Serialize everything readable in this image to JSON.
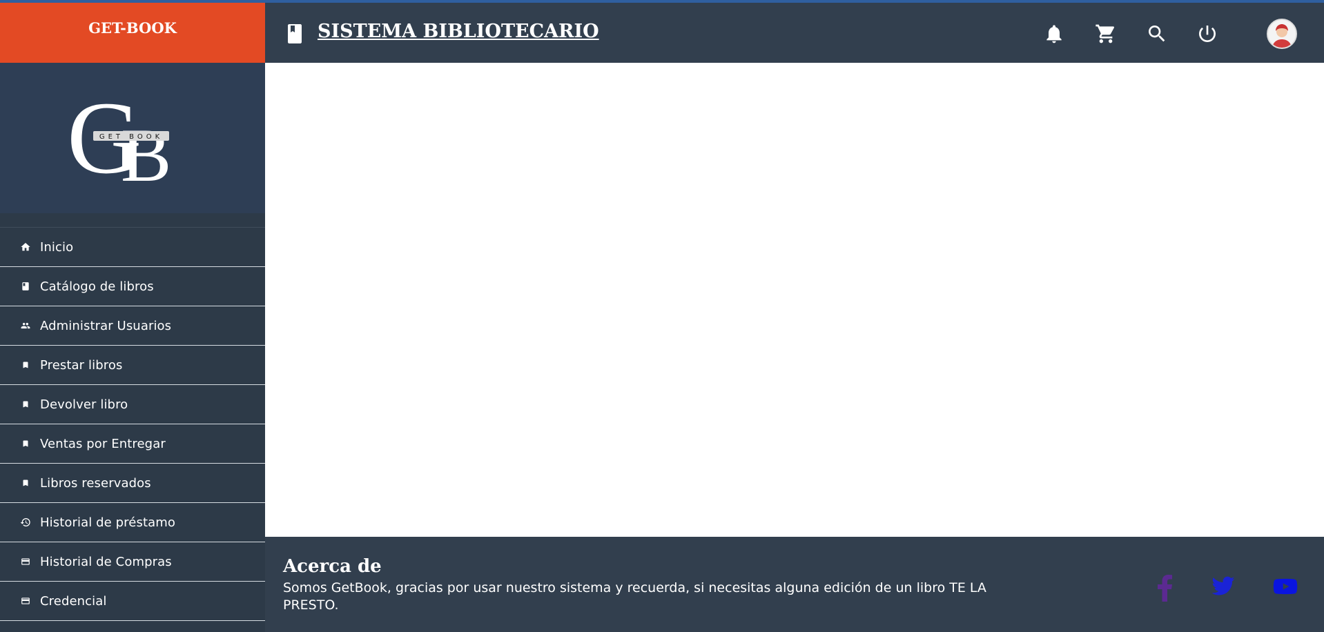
{
  "brand": {
    "title": "GET-BOOK",
    "logo_text": "GET BOOK",
    "logo_letters": "GB"
  },
  "header": {
    "title": "SISTEMA BIBLIOTECARIO"
  },
  "menu": [
    {
      "label": "Inicio",
      "icon": "home-icon"
    },
    {
      "label": "Catálogo de libros",
      "icon": "book-icon"
    },
    {
      "label": "Administrar Usuarios",
      "icon": "people-icon"
    },
    {
      "label": "Prestar libros",
      "icon": "bookmark-icon"
    },
    {
      "label": "Devolver libro",
      "icon": "bookmark-icon"
    },
    {
      "label": "Ventas por Entregar",
      "icon": "bookmark-icon"
    },
    {
      "label": "Libros reservados",
      "icon": "bookmark-icon"
    },
    {
      "label": "Historial de préstamo",
      "icon": "history-icon"
    },
    {
      "label": "Historial de Compras",
      "icon": "card-icon"
    },
    {
      "label": "Credencial",
      "icon": "card-icon"
    }
  ],
  "footer": {
    "title": "Acerca de",
    "text": "Somos GetBook, gracias por usar nuestro sistema y recuerda, si necesitas alguna edición de un libro TE LA PRESTO."
  },
  "colors": {
    "brand_orange": "#e34a24",
    "sidebar_bg": "#2d3a48",
    "header_bg": "#323f4e",
    "facebook": "#5b2a91",
    "twitter": "#1a23d6",
    "youtube": "#0a14e0"
  }
}
